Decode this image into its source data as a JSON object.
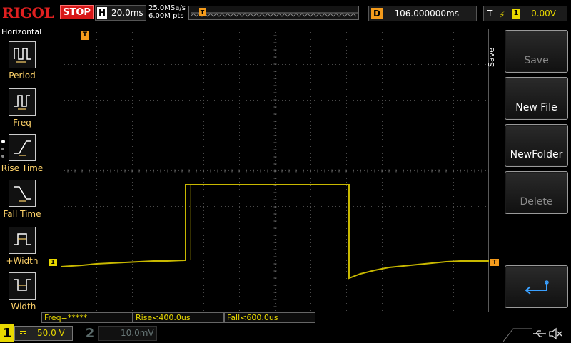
{
  "topbar": {
    "logo": "RIGOL",
    "run_state": "STOP",
    "timebase_label": "H",
    "timebase_value": "20.0ms",
    "sample_rate": "25.0MSa/s",
    "memory_depth": "6.00M pts",
    "delay_label": "D",
    "delay_value": "106.000000ms",
    "trigger_label": "T",
    "trigger_edge_icon": "rising-edge-icon",
    "trigger_source": "1",
    "trigger_level": "0.00V"
  },
  "left_menu": {
    "title": "Horizontal",
    "items": [
      {
        "label": "Period"
      },
      {
        "label": "Freq"
      },
      {
        "label": "Rise Time"
      },
      {
        "label": "Fall Time"
      },
      {
        "label": "+Width"
      },
      {
        "label": "-Width"
      }
    ]
  },
  "markers": {
    "trigger_pos": "T",
    "ch1_ground": "1",
    "trigger_level": "T"
  },
  "right_menu": {
    "title": "Save",
    "buttons": [
      {
        "label": "Save",
        "enabled": false
      },
      {
        "label": "New File",
        "enabled": true
      },
      {
        "label": "NewFolder",
        "enabled": true
      },
      {
        "label": "Delete",
        "enabled": false
      },
      {
        "label": "",
        "icon": "enter-return-icon",
        "enabled": true
      }
    ]
  },
  "measurements": [
    {
      "text": "Freq=*****"
    },
    {
      "text": "Rise<400.0us"
    },
    {
      "text": "Fall<600.0us"
    }
  ],
  "channels": {
    "ch1": {
      "number": "1",
      "scale": "50.0 V",
      "color": "#e8d800"
    },
    "ch2": {
      "number": "2",
      "scale": "10.0mV",
      "color": "#5a6a6a"
    }
  },
  "status_icons": [
    "usb-icon",
    "speaker-muted-icon"
  ],
  "colors": {
    "ch1_trace": "#e8d800",
    "trigger_marker": "#f49b1c",
    "stop": "#d81818",
    "grid": "#5a5a5a"
  }
}
